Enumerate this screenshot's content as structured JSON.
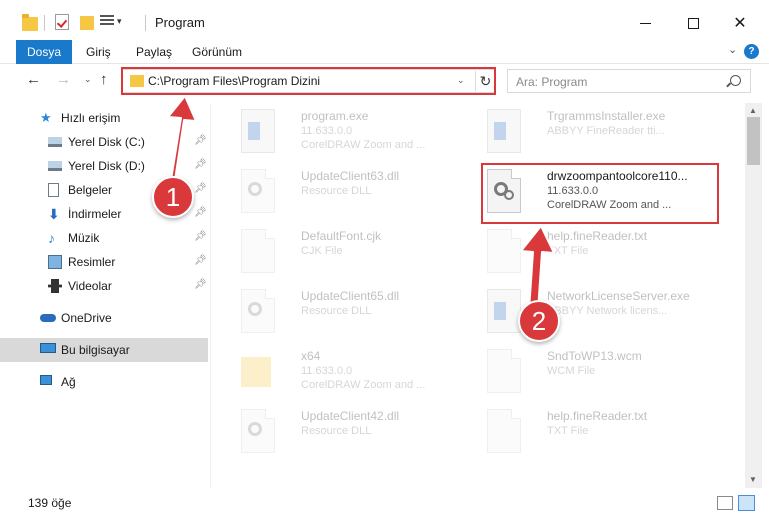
{
  "window": {
    "title": "Program"
  },
  "ribbon": {
    "tabs": [
      "Dosya",
      "Giriş",
      "Paylaş",
      "Görünüm"
    ]
  },
  "nav": {
    "address": "C:\\Program Files\\Program Dizini",
    "search_placeholder": "Ara: Program"
  },
  "sidebar": {
    "items": [
      {
        "label": "Hızlı erişim",
        "icon": "star-icon"
      },
      {
        "label": "Yerel Disk (C:)",
        "icon": "disk-icon"
      },
      {
        "label": "Yerel Disk (D:)",
        "icon": "disk-icon"
      },
      {
        "label": "Belgeler",
        "icon": "documents-icon"
      },
      {
        "label": "İndirmeler",
        "icon": "download-icon"
      },
      {
        "label": "Müzik",
        "icon": "music-icon"
      },
      {
        "label": "Resimler",
        "icon": "pictures-icon"
      },
      {
        "label": "Videolar",
        "icon": "video-icon"
      },
      {
        "label": "OneDrive",
        "icon": "cloud-icon"
      },
      {
        "label": "Bu bilgisayar",
        "icon": "pc-icon"
      },
      {
        "label": "Ağ",
        "icon": "network-icon"
      }
    ]
  },
  "files": [
    {
      "name": "program.exe",
      "line1": "11.633.0.0",
      "line2": "CorelDRAW Zoom and ..."
    },
    {
      "name": "TrgrammsInstaller.exe",
      "line1": "ABBYY FineReader tti...",
      "line2": ""
    },
    {
      "name": "UpdateClient63.dll",
      "line1": "Resource DLL",
      "line2": ""
    },
    {
      "name": "drwzoompantoolcore110...",
      "line1": "11.633.0.0",
      "line2": "CorelDRAW Zoom and ..."
    },
    {
      "name": "DefaultFont.cjk",
      "line1": "CJK File",
      "line2": ""
    },
    {
      "name": "help.fineReader.txt",
      "line1": "TXT File",
      "line2": ""
    },
    {
      "name": "UpdateClient65.dll",
      "line1": "Resource DLL",
      "line2": ""
    },
    {
      "name": "NetworkLicenseServer.exe",
      "line1": "ABBYY Network licens...",
      "line2": ""
    },
    {
      "name": "x64",
      "line1": "11.633.0.0",
      "line2": "CorelDRAW Zoom and ..."
    },
    {
      "name": "SndToWP13.wcm",
      "line1": "WCM File",
      "line2": ""
    },
    {
      "name": "UpdateClient42.dll",
      "line1": "Resource DLL",
      "line2": ""
    },
    {
      "name": "help.fineReader.txt",
      "line1": "TXT File",
      "line2": ""
    }
  ],
  "status": {
    "count": "139 öğe"
  },
  "annotations": {
    "badge1": "1",
    "badge2": "2",
    "color": "#d9393b"
  }
}
